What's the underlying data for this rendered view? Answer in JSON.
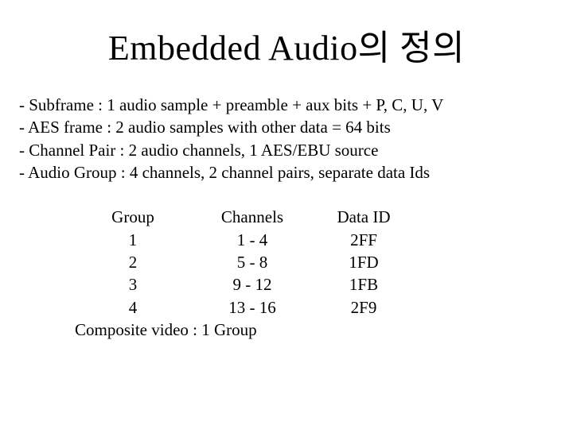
{
  "title": "Embedded Audio의 정의",
  "bullets": [
    "- Subframe : 1 audio sample + preamble + aux bits + P, C, U, V",
    "- AES frame : 2 audio samples with other data = 64 bits",
    "- Channel Pair : 2 audio channels, 1 AES/EBU source",
    "- Audio Group : 4 channels, 2 channel pairs, separate data Ids"
  ],
  "table": {
    "headers": {
      "group": "Group",
      "channels": "Channels",
      "data_id": "Data ID"
    },
    "rows": [
      {
        "group": "1",
        "channels": "1 - 4",
        "data_id": "2FF"
      },
      {
        "group": "2",
        "channels": "5 - 8",
        "data_id": "1FD"
      },
      {
        "group": "3",
        "channels": "9 - 12",
        "data_id": "1FB"
      },
      {
        "group": "4",
        "channels": "13 - 16",
        "data_id": "2F9"
      }
    ]
  },
  "footer": "Composite video : 1 Group"
}
